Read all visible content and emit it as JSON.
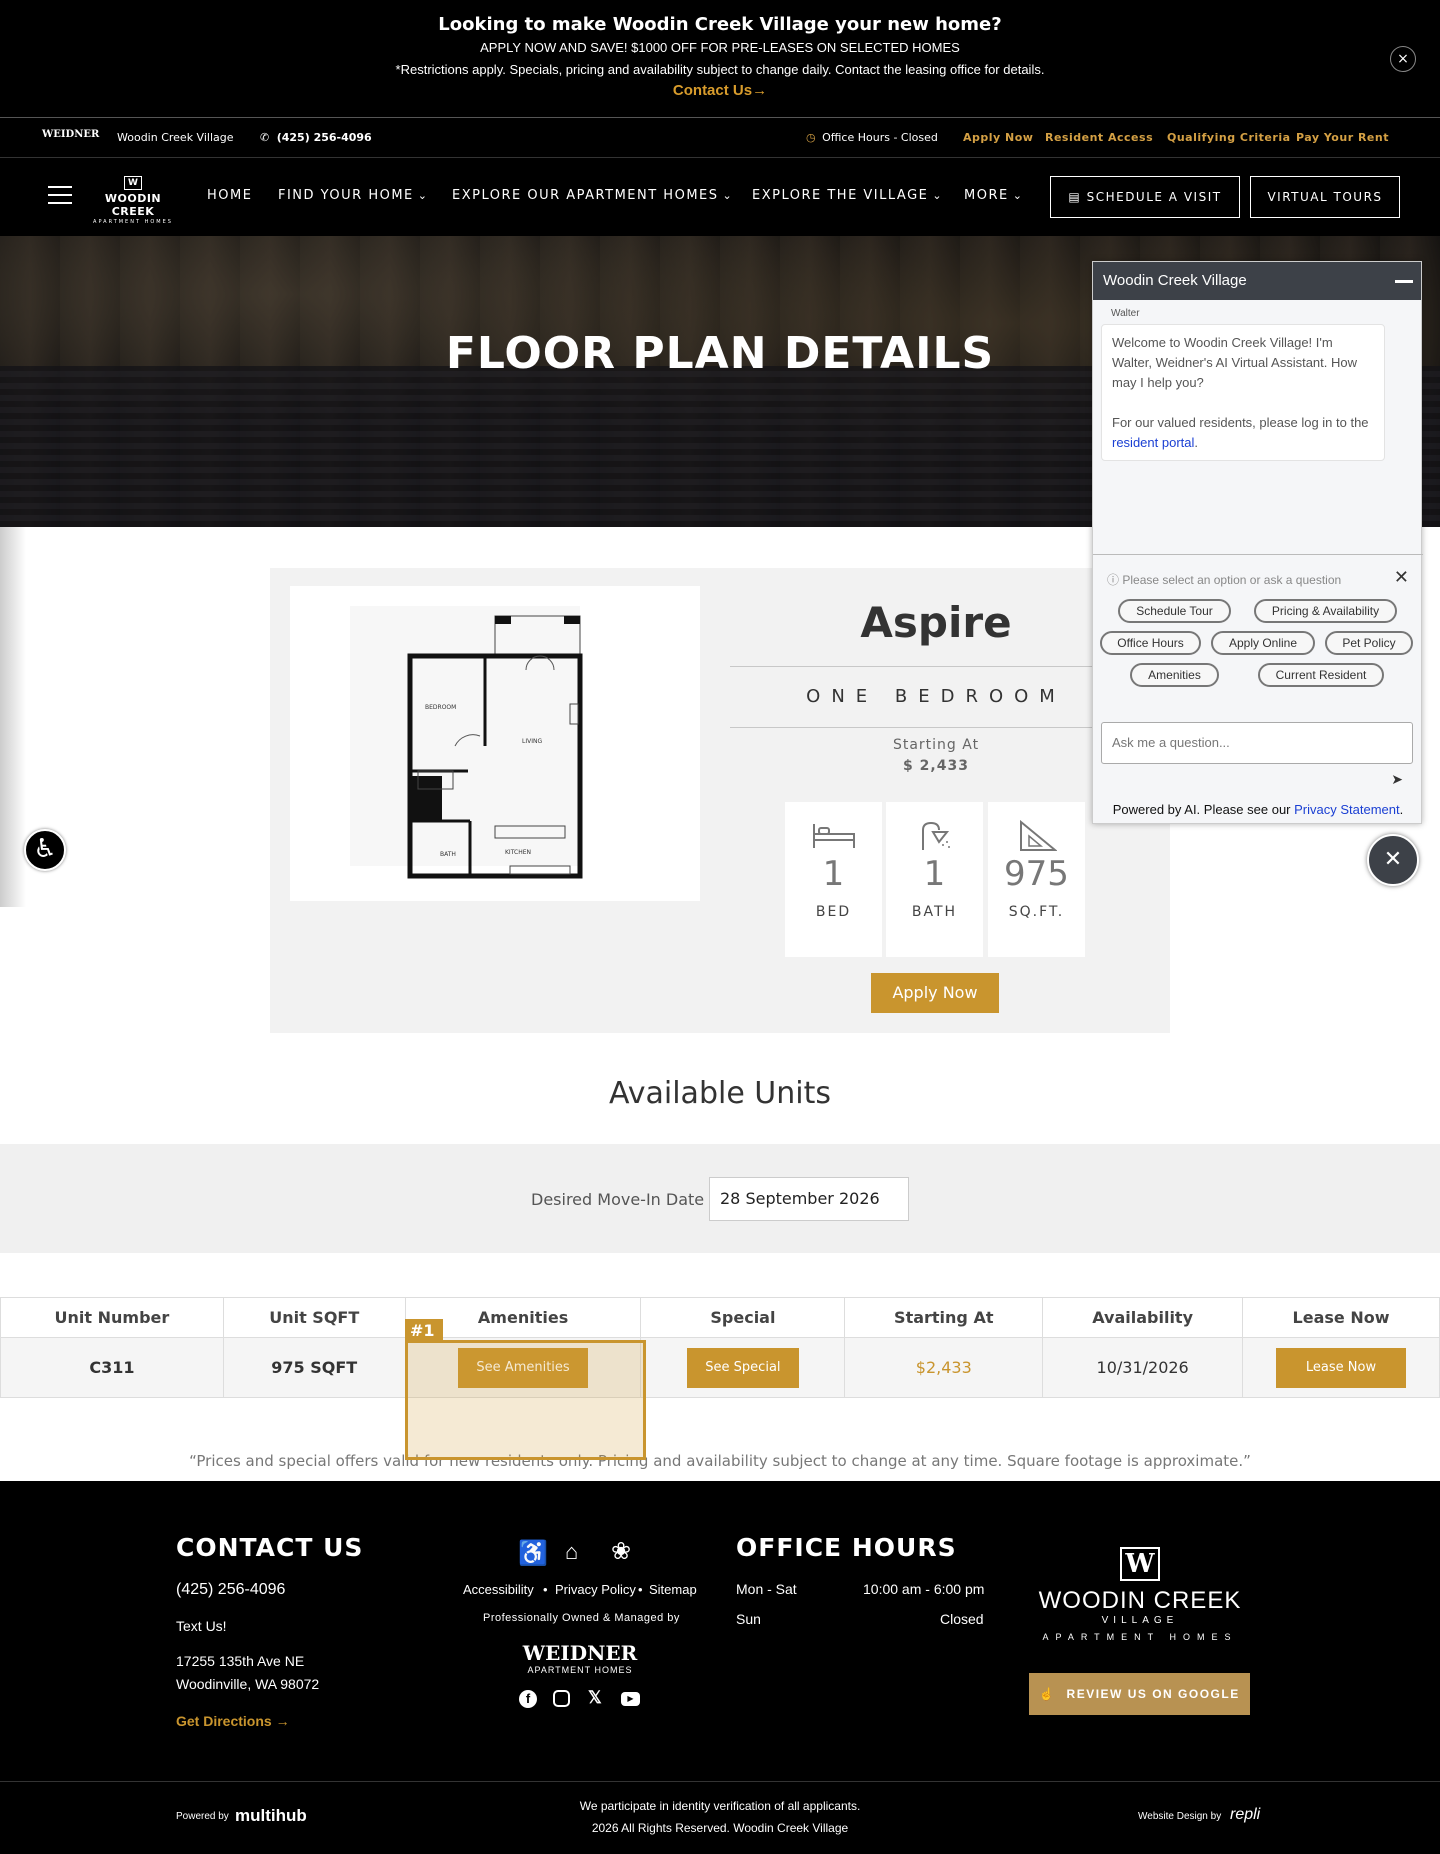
{
  "promo": {
    "headline": "Looking to make Woodin Creek Village your new home?",
    "line1": "APPLY NOW AND SAVE! $1000 OFF FOR PRE-LEASES ON SELECTED HOMES",
    "line2": "*Restrictions apply. Specials, pricing and availability subject to change daily. Contact the leasing office for details.",
    "cta": "Contact Us→",
    "close": "×"
  },
  "utility": {
    "mgmt_logo": "WEIDNER",
    "property": "Woodin Creek Village",
    "phone": "(425) 256-4096",
    "hours": "Office Hours - Closed",
    "links": [
      "Apply Now",
      "Resident Access",
      "Qualifying Criteria",
      "Pay Your Rent"
    ]
  },
  "nav": {
    "brand_mark": "W",
    "brand_name": "WOODIN CREEK",
    "brand_sub": "APARTMENT HOMES",
    "items": [
      "HOME",
      "FIND YOUR HOME",
      "EXPLORE OUR APARTMENT HOMES",
      "EXPLORE THE VILLAGE",
      "MORE"
    ],
    "schedule": "SCHEDULE A VISIT",
    "tours": "VIRTUAL TOURS"
  },
  "hero": {
    "title": "FLOOR PLAN DETAILS"
  },
  "plan": {
    "name": "Aspire",
    "type": "ONE BEDROOM",
    "starting_label": "Starting At",
    "starting_value": "$ 2,433",
    "stats": [
      {
        "value": "1",
        "label": "BED",
        "icon": "bed-icon"
      },
      {
        "value": "1",
        "label": "BATH",
        "icon": "shower-icon"
      },
      {
        "value": "975",
        "label": "SQ.FT.",
        "icon": "ruler-icon"
      }
    ],
    "room_labels": {
      "bedroom": "BEDROOM",
      "living": "LIVING",
      "bath": "BATH",
      "kitchen": "KITCHEN"
    },
    "apply": "Apply Now"
  },
  "units": {
    "title": "Available Units",
    "date_label": "Desired Move-In Date",
    "date_value": "28 September 2026",
    "columns": [
      "Unit Number",
      "Unit SQFT",
      "Amenities",
      "Special",
      "Starting At",
      "Availability",
      "Lease Now"
    ],
    "rows": [
      {
        "unit": "C311",
        "sqft": "975 SQFT",
        "amenities": "See Amenities",
        "special": "See Special",
        "price": "$2,433",
        "availability": "10/31/2026",
        "lease": "Lease Now"
      }
    ],
    "highlight_tag": "#1",
    "disclaimer": "“Prices and special offers valid for new residents only. Pricing and availability subject to change at any time. Square footage is approximate.”"
  },
  "footer": {
    "contact_title": "CONTACT US",
    "phone": "(425) 256-4096",
    "text_us": "Text Us!",
    "address1": "17255 135th Ave NE",
    "address2": "Woodinville, WA 98072",
    "directions": "Get Directions →",
    "links": [
      "Accessibility",
      "Privacy Policy",
      "Sitemap"
    ],
    "managed_by": "Professionally Owned & Managed by",
    "mgmt_name": "WEIDNER",
    "mgmt_sub": "APARTMENT HOMES",
    "hours_title": "OFFICE HOURS",
    "hours": [
      {
        "days": "Mon - Sat",
        "time": "10:00 am - 6:00 pm"
      },
      {
        "days": "Sun",
        "time": "Closed"
      }
    ],
    "brand_name": "WOODIN CREEK",
    "brand_village": "VILLAGE",
    "brand_sub": "APARTMENT HOMES",
    "review": "REVIEW US ON GOOGLE",
    "powered_by": "Powered by",
    "powered_name": "multihub",
    "verify": "We participate in identity verification of all applicants.",
    "copyright": "2026 All Rights Reserved. Woodin Creek Village",
    "design_by": "Website Design by",
    "design_name": "repli"
  },
  "chat": {
    "title": "Woodin Creek Village",
    "agent": "Walter",
    "message": "Welcome to Woodin Creek Village! I'm Walter, Weidner's AI Virtual Assistant. How may I help you?",
    "message2_pre": "For our valued residents, please log in to the",
    "message2_link": "resident portal",
    "message2_post": ".",
    "prompt": "Please select an option or ask a question",
    "chips": [
      "Schedule Tour",
      "Pricing & Availability",
      "Office Hours",
      "Apply Online",
      "Pet Policy",
      "Amenities",
      "Current Resident"
    ],
    "input_placeholder": "Ask me a question...",
    "footer_pre": "Powered by AI. Please see our",
    "footer_link": "Privacy Statement",
    "footer_post": "."
  },
  "colors": {
    "accent": "#c9952e",
    "dark": "#000000",
    "chat_header": "#3d4148"
  }
}
